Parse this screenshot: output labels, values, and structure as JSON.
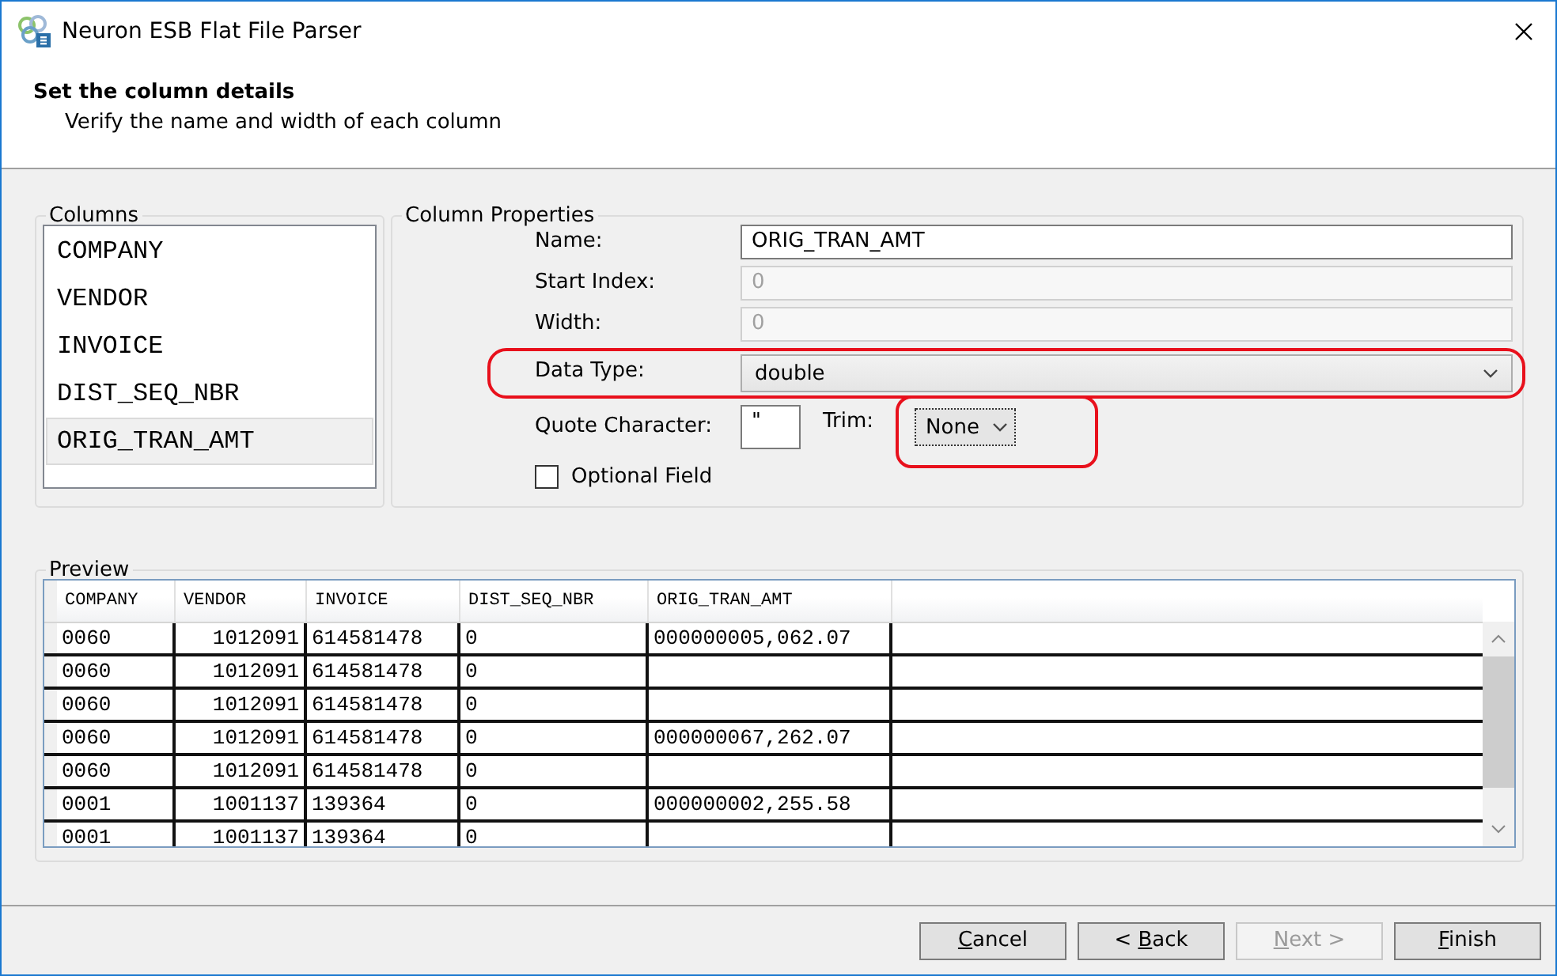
{
  "window": {
    "title": "Neuron ESB Flat File Parser"
  },
  "header": {
    "title": "Set the column details",
    "subtitle": "Verify the name and width of each column"
  },
  "columns_group": {
    "legend": "Columns",
    "items": [
      {
        "label": "COMPANY",
        "selected": false
      },
      {
        "label": "VENDOR",
        "selected": false
      },
      {
        "label": "INVOICE",
        "selected": false
      },
      {
        "label": "DIST_SEQ_NBR",
        "selected": false
      },
      {
        "label": "ORIG_TRAN_AMT",
        "selected": true
      }
    ]
  },
  "properties": {
    "legend": "Column Properties",
    "name": {
      "label": "Name:",
      "value": "ORIG_TRAN_AMT",
      "disabled": false
    },
    "start_index": {
      "label": "Start Index:",
      "value": "0",
      "disabled": true
    },
    "width": {
      "label": "Width:",
      "value": "0",
      "disabled": true
    },
    "data_type": {
      "label": "Data Type:",
      "value": "double",
      "highlighted": true
    },
    "quote_character": {
      "label": "Quote Character:",
      "value": "\""
    },
    "trim": {
      "label": "Trim:",
      "value": "None",
      "highlighted": true
    },
    "optional_field": {
      "label": "Optional Field",
      "checked": false
    }
  },
  "preview": {
    "legend": "Preview",
    "columns": [
      {
        "label": "COMPANY"
      },
      {
        "label": "VENDOR"
      },
      {
        "label": "INVOICE"
      },
      {
        "label": "DIST_SEQ_NBR"
      },
      {
        "label": "ORIG_TRAN_AMT"
      }
    ],
    "rows": [
      [
        "0060",
        "1012091",
        "614581478",
        "0",
        "000000005,062.07"
      ],
      [
        "0060",
        "1012091",
        "614581478",
        "0",
        null
      ],
      [
        "0060",
        "1012091",
        "614581478",
        "0",
        null
      ],
      [
        "0060",
        "1012091",
        "614581478",
        "0",
        "000000067,262.07"
      ],
      [
        "0060",
        "1012091",
        "614581478",
        "0",
        null
      ],
      [
        "0001",
        "1001137",
        "139364",
        "0",
        "000000002,255.58"
      ],
      [
        "0001",
        "1001137",
        "139364",
        "0",
        null
      ]
    ]
  },
  "buttons": [
    {
      "label": "Cancel",
      "disabled": false
    },
    {
      "label": "< Back",
      "disabled": false
    },
    {
      "label": "Next >",
      "disabled": true
    },
    {
      "label": "Finish",
      "disabled": false
    }
  ]
}
